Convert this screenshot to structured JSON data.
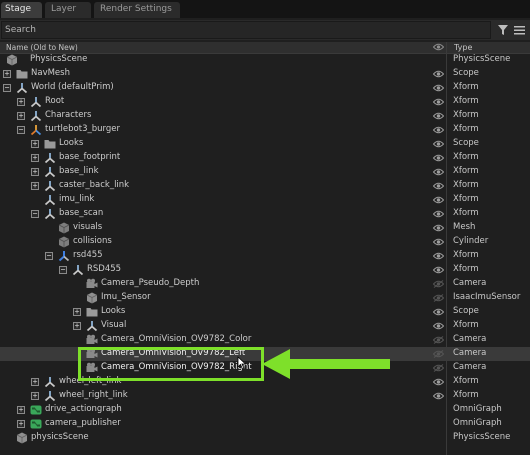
{
  "tabs": [
    {
      "label": "Stage",
      "active": true
    },
    {
      "label": "Layer",
      "active": false
    },
    {
      "label": "Render Settings",
      "active": false
    }
  ],
  "search": {
    "placeholder": "Search"
  },
  "columns": {
    "name": "Name (Old to New)",
    "type": "Type"
  },
  "colors": {
    "accent": "#7ee02a",
    "selected_row": "#3a3a3a",
    "background": "#1f1f1f"
  },
  "rows": [
    {
      "label": "PhysicsScene",
      "type": "PhysicsScene",
      "icon": "prim-cube-icon"
    },
    {
      "label": "NavMesh",
      "type": "Scope",
      "icon": "folder-icon"
    },
    {
      "label": "World (defaultPrim)",
      "type": "Xform",
      "icon": "xform-icon"
    },
    {
      "label": "Root",
      "type": "Xform",
      "icon": "xform-icon"
    },
    {
      "label": "Characters",
      "type": "Xform",
      "icon": "xform-icon"
    },
    {
      "label": "turtlebot3_burger",
      "type": "Xform",
      "icon": "articulation-icon"
    },
    {
      "label": "Looks",
      "type": "Scope",
      "icon": "folder-icon"
    },
    {
      "label": "base_footprint",
      "type": "Xform",
      "icon": "xform-icon"
    },
    {
      "label": "base_link",
      "type": "Xform",
      "icon": "xform-icon"
    },
    {
      "label": "caster_back_link",
      "type": "Xform",
      "icon": "xform-icon"
    },
    {
      "label": "imu_link",
      "type": "Xform",
      "icon": "xform-icon"
    },
    {
      "label": "base_scan",
      "type": "Xform",
      "icon": "xform-icon"
    },
    {
      "label": "visuals",
      "type": "Mesh",
      "icon": "mesh-icon"
    },
    {
      "label": "collisions",
      "type": "Cylinder",
      "icon": "mesh-icon"
    },
    {
      "label": "rsd455",
      "type": "Xform",
      "icon": "xform-blue-icon"
    },
    {
      "label": "RSD455",
      "type": "Xform",
      "icon": "xform-icon"
    },
    {
      "label": "Camera_Pseudo_Depth",
      "type": "Camera",
      "icon": "camera-icon"
    },
    {
      "label": "Imu_Sensor",
      "type": "IsaacImuSensor",
      "icon": "sensor-icon"
    },
    {
      "label": "Looks",
      "type": "Scope",
      "icon": "folder-icon"
    },
    {
      "label": "Visual",
      "type": "Xform",
      "icon": "xform-icon"
    },
    {
      "label": "Camera_OmniVision_OV9782_Color",
      "type": "Camera",
      "icon": "camera-icon"
    },
    {
      "label": "Camera_OmniVision_OV9782_Left",
      "type": "Camera",
      "icon": "camera-icon"
    },
    {
      "label": "Camera_OmniVision_OV9782_Right",
      "type": "Camera",
      "icon": "camera-icon"
    },
    {
      "label": "wheel_left_link",
      "type": "Xform",
      "icon": "xform-icon"
    },
    {
      "label": "wheel_right_link",
      "type": "Xform",
      "icon": "xform-icon"
    },
    {
      "label": "drive_actiongraph",
      "type": "OmniGraph",
      "icon": "graph-icon"
    },
    {
      "label": "camera_publisher",
      "type": "OmniGraph",
      "icon": "graph-icon"
    },
    {
      "label": "physicsScene",
      "type": "PhysicsScene",
      "icon": "prim-cube-icon"
    }
  ]
}
